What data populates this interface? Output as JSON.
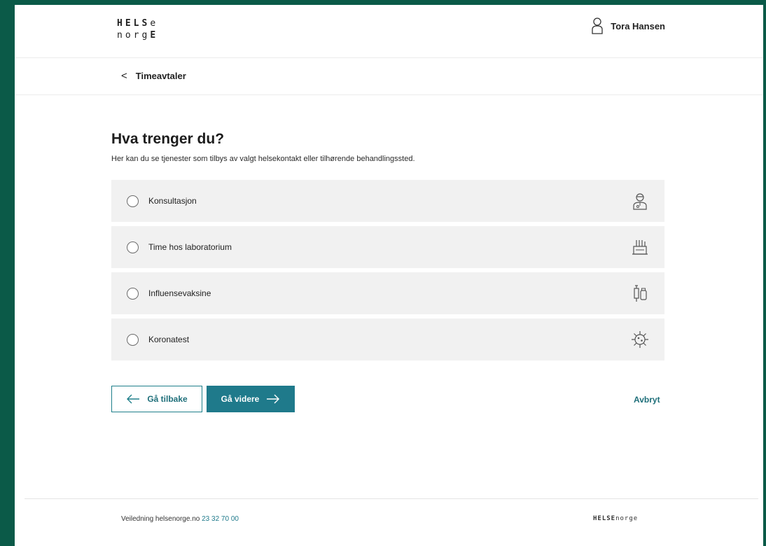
{
  "brand": {
    "logo_line1_bold": "HELS",
    "logo_line1_light": "e",
    "logo_line2_light": "norg",
    "logo_line2_bold": "E"
  },
  "header": {
    "user_icon": "person-icon",
    "user_name": "Tora Hansen"
  },
  "breadcrumb": {
    "chevron": "<",
    "label": "Timeavtaler"
  },
  "main": {
    "title": "Hva trenger du?",
    "subtitle": "Her kan du se tjenester som tilbys av valgt helsekontakt eller tilhørende behandlingssted.",
    "options": [
      {
        "label": "Konsultasjon",
        "icon": "doctor-icon"
      },
      {
        "label": "Time hos laboratorium",
        "icon": "laboratory-icon"
      },
      {
        "label": "Influensevaksine",
        "icon": "vaccine-icon"
      },
      {
        "label": "Koronatest",
        "icon": "virus-icon"
      }
    ]
  },
  "actions": {
    "back_label": "Gå tilbake",
    "next_label": "Gå videre",
    "cancel_label": "Avbryt"
  },
  "footer": {
    "text": "Veiledning helsenorge.no",
    "phone": "23 32 70 00",
    "logo_bold": "HELSE",
    "logo_light": "norge"
  },
  "colors": {
    "frame": "#0b5a48",
    "primary": "#1f7a8b",
    "option_bg": "#f1f1f1"
  }
}
